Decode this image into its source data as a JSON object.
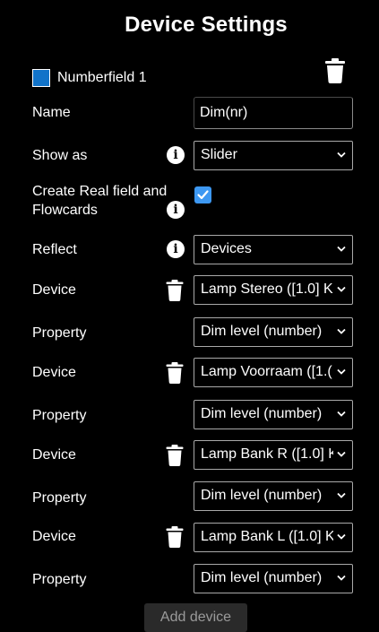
{
  "header": {
    "title": "Device Settings"
  },
  "field": {
    "name": "Numberfield 1",
    "color": "#1173c9"
  },
  "form": {
    "name_label": "Name",
    "name_value": "Dim(nr)",
    "show_as_label": "Show as",
    "show_as_value": "Slider",
    "create_label_line1": "Create Real field and",
    "create_label_line2": "Flowcards",
    "create_checked": true,
    "reflect_label": "Reflect",
    "reflect_value": "Devices"
  },
  "devices": [
    {
      "device_label": "Device",
      "device_value": "Lamp Stereo ([1.0] K",
      "property_label": "Property",
      "property_value": "Dim level (number)"
    },
    {
      "device_label": "Device",
      "device_value": "Lamp Voorraam ([1.(",
      "property_label": "Property",
      "property_value": "Dim level (number)"
    },
    {
      "device_label": "Device",
      "device_value": "Lamp Bank R ([1.0] K",
      "property_label": "Property",
      "property_value": "Dim level (number)"
    },
    {
      "device_label": "Device",
      "device_value": "Lamp Bank L ([1.0] K",
      "property_label": "Property",
      "property_value": "Dim level (number)"
    }
  ],
  "actions": {
    "add_device_label": "Add device"
  },
  "icons": {
    "trash": "trash-icon",
    "info": "info-icon",
    "chevron": "chevron-down-icon",
    "check": "check-icon"
  },
  "colors": {
    "background": "#000000",
    "accent": "#3d98f2",
    "text": "#ffffff"
  }
}
